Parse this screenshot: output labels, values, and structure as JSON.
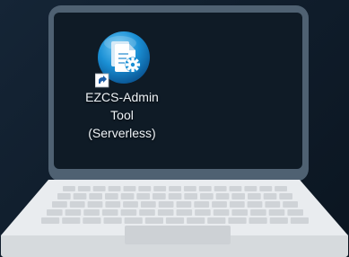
{
  "desktop": {
    "icon": {
      "name": "application-icon",
      "label_lines": [
        "EZCS-Admin",
        "Tool",
        "(Serverless)"
      ],
      "has_shortcut_arrow": true
    }
  },
  "colors": {
    "background": "#122233",
    "laptop_lid": "#4f6172",
    "screen": "#0f1b26",
    "keyboard_deck": "#e9ecef",
    "keys": "#cfd3d7",
    "icon_blue": "#1a8fd4",
    "label_text": "#eef3f7"
  }
}
